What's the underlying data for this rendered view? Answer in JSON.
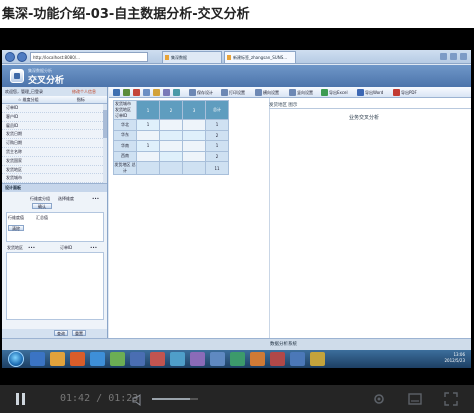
{
  "title": "集深-功能介绍-03-自主数据分析-交叉分析",
  "browser": {
    "address": "http://localhost:8080/...",
    "tabs": [
      {
        "label": "集深数据"
      },
      {
        "label": "新建标签_zhangsan_SUNS..."
      }
    ]
  },
  "app": {
    "subtitle": "集深数据分析",
    "name": "交叉分析"
  },
  "left_panel": {
    "user_row": "欢迎您，管理_已登录",
    "user_link": "修改个人信息",
    "tabs": [
      "☆ 维度分组",
      "指标"
    ],
    "tree_items": [
      "订单ID",
      "客户ID",
      "雇员ID",
      "发货日期",
      "订购日期",
      "货主名称",
      "发货国家",
      "发货地区",
      "发货城市"
    ],
    "design_head": "设计面板",
    "labels": {
      "row_dim": "行维度分组",
      "col_dim": "选择维度",
      "row_measure": "行维度值",
      "aggregate": "汇总值",
      "country": "发货地区",
      "order": "订单ID",
      "row_x": "行维度值"
    },
    "buttons": {
      "confirm": "确认",
      "clear": "清除",
      "query": "查询",
      "reset": "重置"
    },
    "more1": "•••",
    "more2": "•••",
    "more3": "•••"
  },
  "toolbar": {
    "items": [
      "保存设计",
      "打印设置",
      "横向设置",
      "竖向设置",
      "导出Excel",
      "导出Word",
      "导出PDF"
    ]
  },
  "grid": {
    "result_title": "发货地区 图示",
    "section_title": "业务交叉分析",
    "corner_top": "发货城市",
    "corner_bottom": "发货地区 订单ID",
    "columns": [
      "1",
      "2",
      "3",
      "总计"
    ],
    "rows": [
      {
        "label": "华北",
        "cells": [
          "1",
          "",
          "",
          "1"
        ]
      },
      {
        "label": "华东",
        "cells": [
          "",
          "",
          "",
          "2"
        ]
      },
      {
        "label": "华南",
        "cells": [
          "1",
          "",
          "",
          "1"
        ]
      },
      {
        "label": "西南",
        "cells": [
          "",
          "",
          "",
          "2"
        ]
      }
    ],
    "total_row": {
      "label": "发货地区 总计",
      "cells": [
        "",
        "",
        "",
        "11"
      ]
    }
  },
  "statusbar": {
    "text": "数据分析系统"
  },
  "taskbar": {
    "clock_time": "13:06",
    "clock_date": "2012/5/23"
  },
  "controls": {
    "current_time": "01:42",
    "separator": "/",
    "duration": "01:23",
    "volume_level": 0.82
  }
}
